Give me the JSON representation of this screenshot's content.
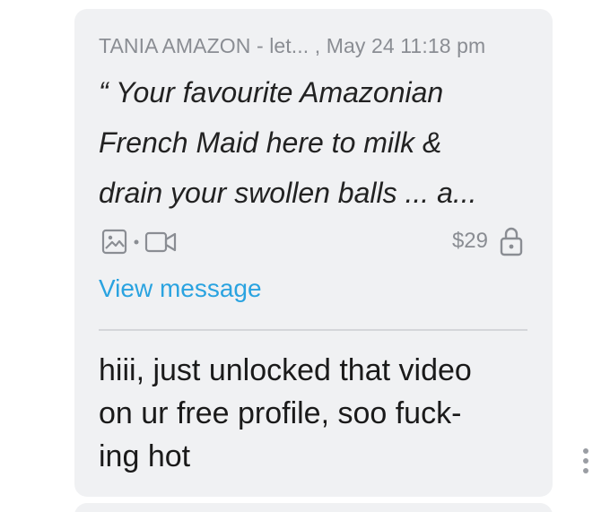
{
  "quoted_message": {
    "header": "TANIA AMAZON - let... , May 24 11:18 pm",
    "lines": [
      "“ Your favourite Amazonian",
      "French Maid here to milk &",
      "drain your swollen balls ... a..."
    ],
    "price": "$29",
    "icons": [
      "image-icon",
      "dot-separator",
      "video-icon",
      "lock-icon"
    ],
    "view_message_label": "View message",
    "accent_color": "#2aa3e0"
  },
  "reply": {
    "lines": [
      "hiii, just unlocked that video",
      "on ur free profile, soo fuck-",
      "ing hot"
    ]
  },
  "actions": {
    "more_icon": "more-vertical-icon"
  }
}
